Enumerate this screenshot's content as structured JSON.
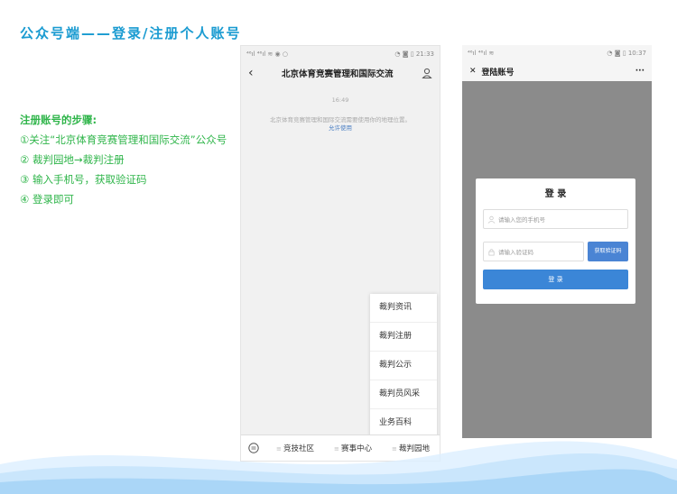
{
  "slide": {
    "title": "公众号端——登录/注册个人账号"
  },
  "steps": {
    "heading": "注册账号的步骤:",
    "items": [
      "①关注“北京体育竞赛管理和国际交流”公众号",
      "② 裁判园地→裁判注册",
      "③ 输入手机号，获取验证码",
      "④ 登录即可"
    ]
  },
  "phone1": {
    "status_left": "⁴⁶ıl ⁴⁶ıl ≋ ◉ ○",
    "status_right": "◔ ◙ ▯ 21:33",
    "header_title": "北京体育竞赛管理和国际交流",
    "chat_time": "16:49",
    "notice": "北京体育竞赛管理和国际交流需要使用你的地理位置。",
    "notice_allow": "允许使用",
    "menu_items": [
      "裁判资讯",
      "裁判注册",
      "裁判公示",
      "裁判员风采",
      "业务百科"
    ],
    "tabs": [
      "竞技社区",
      "赛事中心",
      "裁判园地"
    ]
  },
  "phone2": {
    "status_left": "⁴⁶ıl ⁴⁶ıl ≋",
    "status_right": "◔ ◙ ▯ 10:37",
    "header_title": "登陆账号",
    "login_title": "登 录",
    "phone_placeholder": "请输入您的手机号",
    "code_placeholder": "请输入验证码",
    "get_code_label": "获取验证码",
    "login_label": "登 录"
  },
  "colors": {
    "title": "#1a9bd1",
    "steps": "#2fb54a",
    "button_blue": "#3b86d7"
  }
}
